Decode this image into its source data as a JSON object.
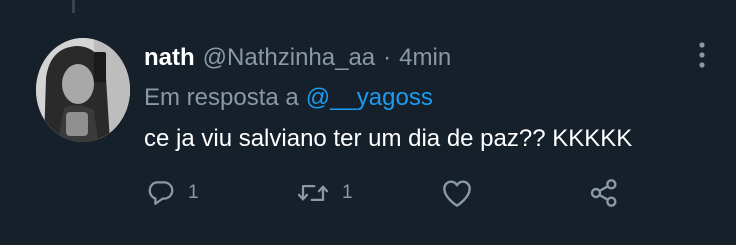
{
  "tweet": {
    "display_name": "nath",
    "handle": "@Nathzinha_aa",
    "separator": "·",
    "time": "4min",
    "reply_prefix": "Em resposta a",
    "reply_mention": "@__yagoss",
    "text": "ce ja viu salviano ter um dia de paz?? KKKKK"
  },
  "actions": {
    "reply": {
      "icon": "reply-icon",
      "count": "1"
    },
    "retweet": {
      "icon": "retweet-icon",
      "count": "1"
    },
    "like": {
      "icon": "heart-icon"
    },
    "share": {
      "icon": "share-icon"
    }
  },
  "colors": {
    "background": "#15202b",
    "primary_text": "#ffffff",
    "secondary_text": "#8b98a5",
    "link": "#1d9bf0"
  }
}
